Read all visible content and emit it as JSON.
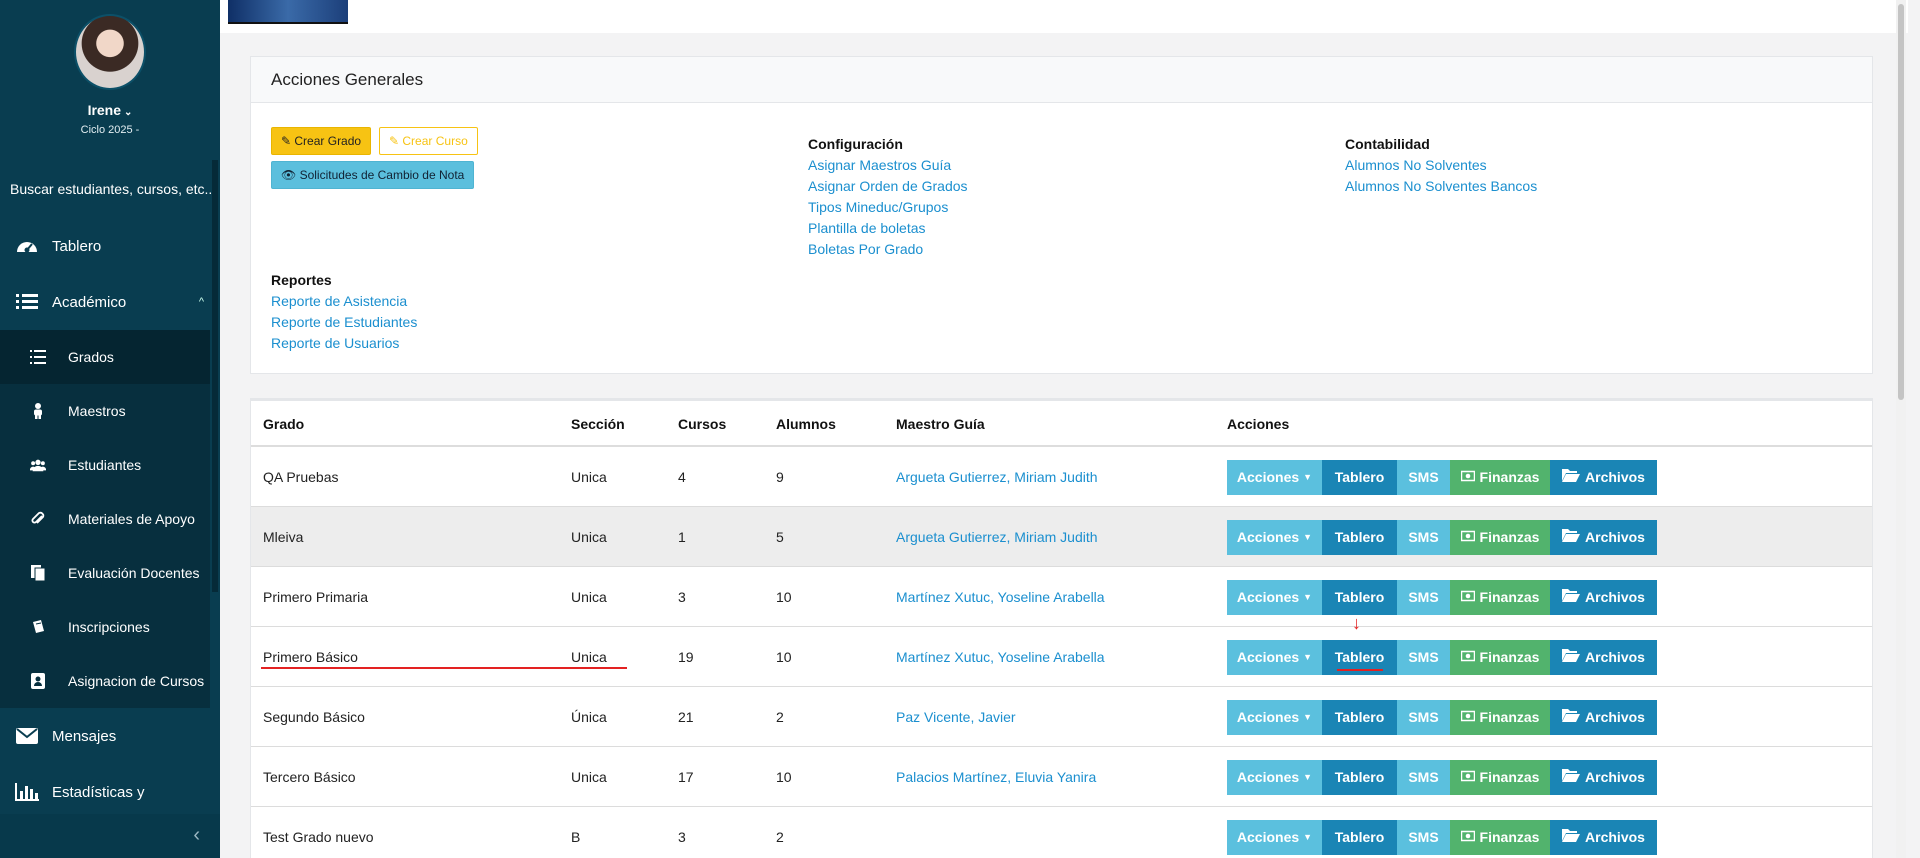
{
  "sidebar": {
    "user_name": "Irene",
    "cycle": "Ciclo 2025 -",
    "search_placeholder": "Buscar estudiantes, cursos, etc...",
    "nav": {
      "tablero": "Tablero",
      "academico": "Académico",
      "mensajes": "Mensajes",
      "estadisticas": "Estadísticas y"
    },
    "sub_items": [
      "Grados",
      "Maestros",
      "Estudiantes",
      "Materiales de Apoyo",
      "Evaluación Docentes",
      "Inscripciones",
      "Asignacion de Cursos"
    ],
    "icons": [
      "dashboard-icon",
      "list-icon",
      "envelope-icon",
      "bar-chart-icon",
      "user-icon",
      "users-icon",
      "paperclip-icon",
      "file-icon",
      "book-icon",
      "id-card-icon",
      "chevron-left-icon"
    ]
  },
  "panel": {
    "title": "Acciones Generales",
    "btn_crear_grado": "Crear Grado",
    "btn_crear_curso": "Crear Curso",
    "btn_solicitudes": "Solicitudes de Cambio de Nota",
    "config_title": "Configuración",
    "config_links": [
      "Asignar Maestros Guía",
      "Asignar Orden de Grados",
      "Tipos Mineduc/Grupos",
      "Plantilla de boletas",
      "Boletas Por Grado"
    ],
    "conta_title": "Contabilidad",
    "conta_links": [
      "Alumnos No Solventes",
      "Alumnos No Solventes Bancos"
    ],
    "reportes_title": "Reportes",
    "reportes_links": [
      "Reporte de Asistencia",
      "Reporte de Estudiantes",
      "Reporte de Usuarios"
    ]
  },
  "table": {
    "headers": [
      "Grado",
      "Sección",
      "Cursos",
      "Alumnos",
      "Maestro Guía",
      "Acciones"
    ],
    "actions": {
      "acciones": "Acciones",
      "tablero": "Tablero",
      "sms": "SMS",
      "finanzas": "Finanzas",
      "archivos": "Archivos"
    },
    "rows": [
      {
        "grado": "QA Pruebas",
        "seccion": "Unica",
        "cursos": "4",
        "alumnos": "9",
        "maestro": "Argueta Gutierrez, Miriam Judith"
      },
      {
        "grado": "Mleiva",
        "seccion": "Unica",
        "cursos": "1",
        "alumnos": "5",
        "maestro": "Argueta Gutierrez, Miriam Judith"
      },
      {
        "grado": "Primero Primaria",
        "seccion": "Unica",
        "cursos": "3",
        "alumnos": "10",
        "maestro": "Martínez Xutuc, Yoseline Arabella"
      },
      {
        "grado": "Primero Básico",
        "seccion": "Unica",
        "cursos": "19",
        "alumnos": "10",
        "maestro": "Martínez Xutuc, Yoseline Arabella"
      },
      {
        "grado": "Segundo Básico",
        "seccion": "Única",
        "cursos": "21",
        "alumnos": "2",
        "maestro": "Paz Vicente, Javier"
      },
      {
        "grado": "Tercero Básico",
        "seccion": "Unica",
        "cursos": "17",
        "alumnos": "10",
        "maestro": "Palacios Martínez, Eluvia Yanira"
      },
      {
        "grado": "Test Grado nuevo",
        "seccion": "B",
        "cursos": "3",
        "alumnos": "2",
        "maestro": ""
      }
    ]
  },
  "colors": {
    "sidebar": "#093d50",
    "primary": "#1a85b5",
    "info": "#5bc0de",
    "success": "#52b36d",
    "warning": "#f7c313",
    "annotation": "#e32222"
  }
}
